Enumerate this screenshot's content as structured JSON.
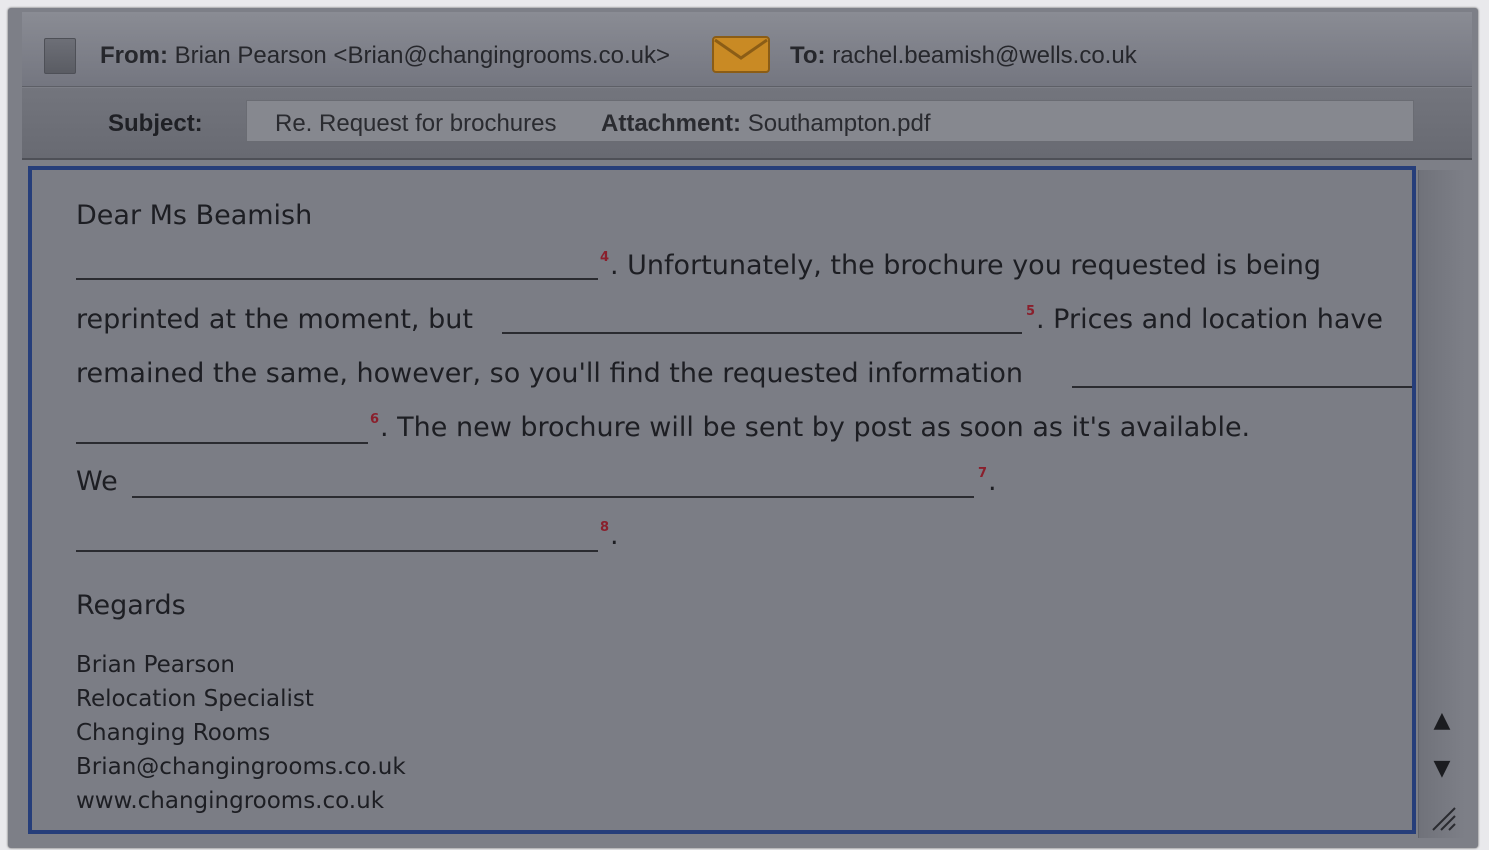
{
  "header": {
    "from_label": "From:",
    "from_value": "Brian Pearson <Brian@changingrooms.co.uk>",
    "to_label": "To:",
    "to_value": "rachel.beamish@wells.co.uk",
    "subject_label": "Subject:",
    "subject_value": "Re. Request for brochures",
    "attachment_label": "Attachment:",
    "attachment_value": "Southampton.pdf",
    "envelope_color": "#d9962a"
  },
  "body": {
    "greeting": "Dear Ms Beamish",
    "gap_numbers": [
      "4",
      "5",
      "6",
      "7",
      "8"
    ],
    "line1_after": ". Unfortunately, the brochure you requested is being",
    "line2_before": "reprinted at the moment, but",
    "line2_after": ". Prices and location have",
    "line3": "remained the same, however, so you'll find the requested information",
    "line4_after": ". The new brochure will be sent by post as soon as it's available.",
    "line5_before": "We",
    "line5_after": ".",
    "line6_after": ".",
    "closing": "Regards"
  },
  "signature": {
    "name": "Brian Pearson",
    "title": "Relocation Specialist",
    "company": "Changing Rooms",
    "email": "Brian@changingrooms.co.uk",
    "website": "www.changingrooms.co.uk"
  },
  "scrollbar": {
    "up_glyph": "▲",
    "down_glyph": "▼"
  }
}
